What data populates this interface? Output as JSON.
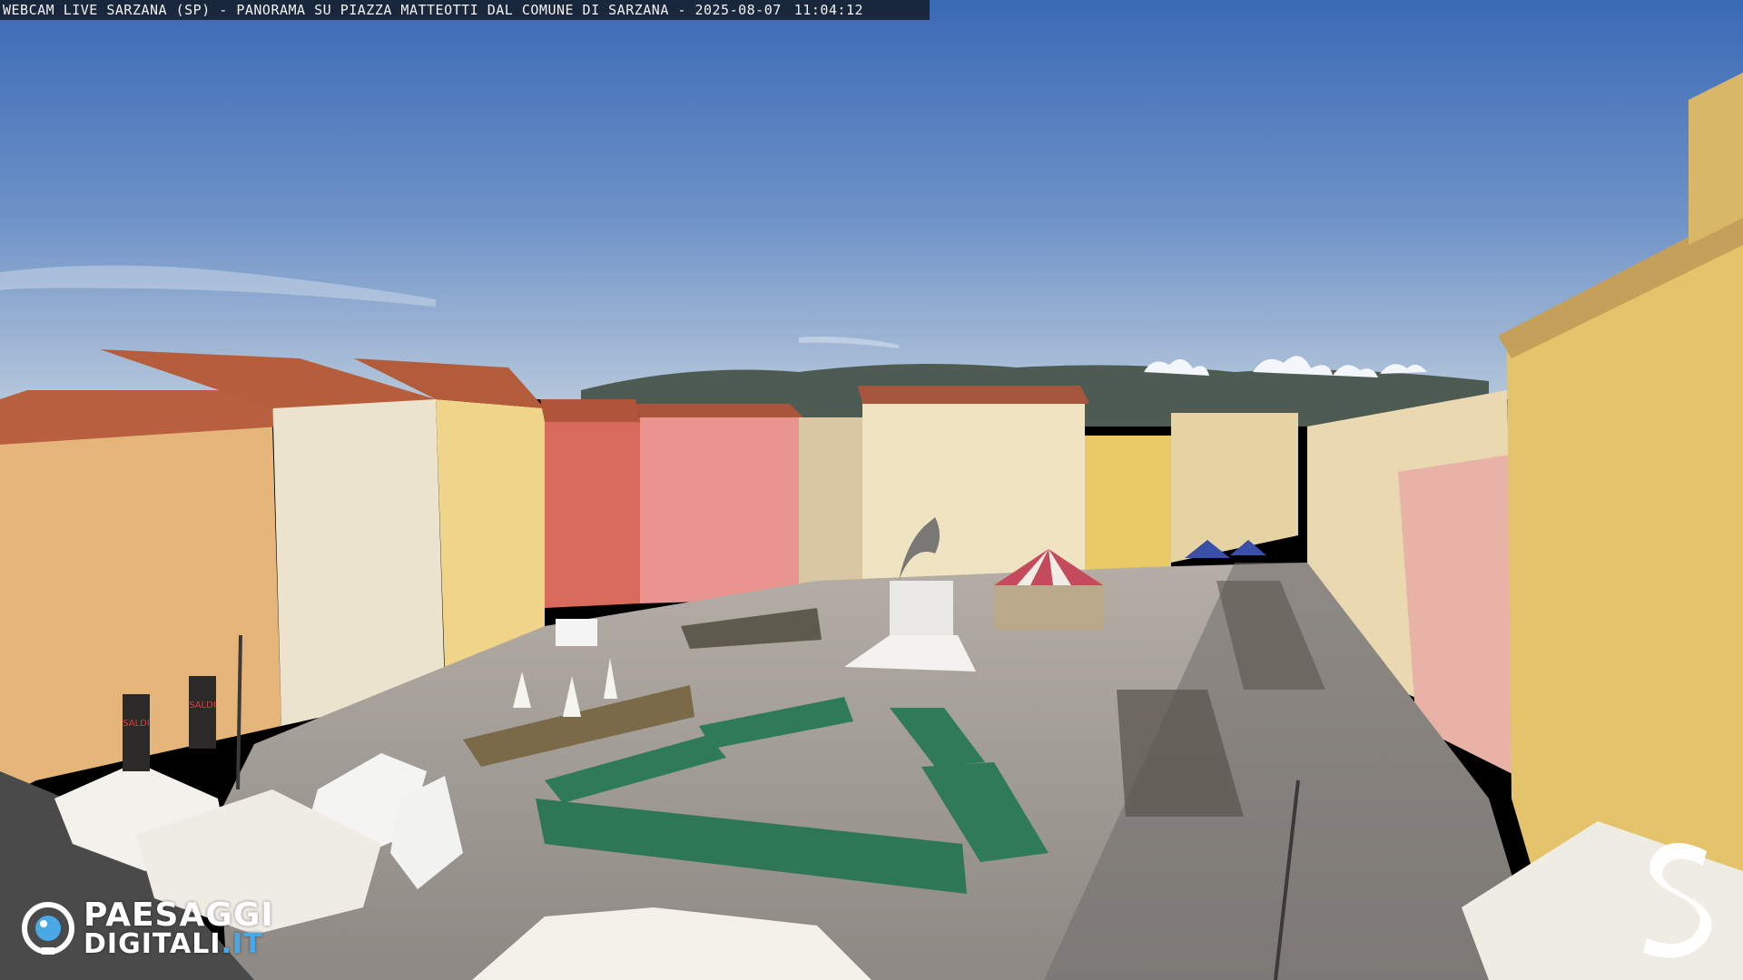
{
  "overlay": {
    "title": "WEBCAM LIVE SARZANA (SP) - PANORAMA SU PIAZZA MATTEOTTI DAL COMUNE DI SARZANA - 2025-08-07",
    "time": "11:04:12"
  },
  "logo": {
    "line1": "PAESAGGI",
    "line2": "DIGITALI",
    "suffix": ".IT",
    "accent_color": "#48a9e6"
  },
  "shop_signs": [
    "SALDI",
    "SALDI"
  ],
  "colors": {
    "sky_top": "#3f6fb8",
    "sky_bottom": "#a9c0d8",
    "pavement": "#9a9590",
    "stall_green": "#2f7a58"
  }
}
